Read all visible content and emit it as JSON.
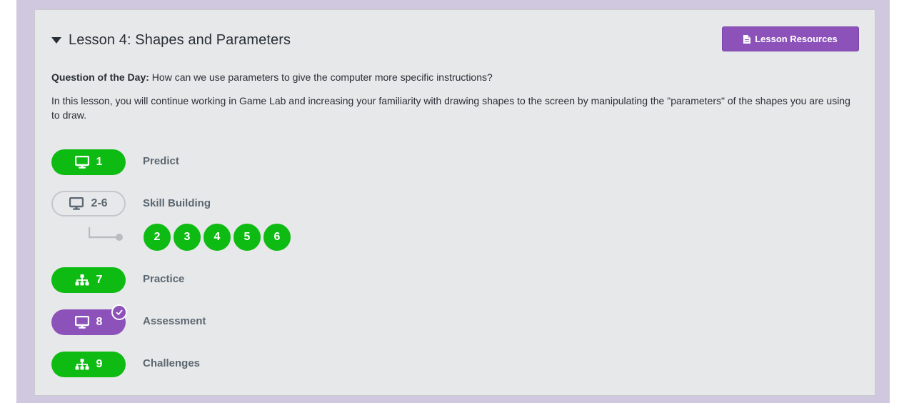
{
  "lesson": {
    "title": "Lesson 4: Shapes and Parameters",
    "resources_label": "Lesson Resources",
    "question_label": "Question of the Day:",
    "question_text": " How can we use parameters to give the computer more specific instructions?",
    "description": "In this lesson, you will continue working in Game Lab and increasing your familiarity with drawing shapes to the screen by manipulating the \"parameters\" of the shapes you are using to draw."
  },
  "levels": [
    {
      "number": "1",
      "label": "Predict",
      "icon": "desktop-icon",
      "status": "complete"
    },
    {
      "number": "2-6",
      "label": "Skill Building",
      "icon": "desktop-icon",
      "status": "progression"
    },
    {
      "number": "7",
      "label": "Practice",
      "icon": "sitemap-icon",
      "status": "complete"
    },
    {
      "number": "8",
      "label": "Assessment",
      "icon": "desktop-icon",
      "status": "assessment-submitted"
    },
    {
      "number": "9",
      "label": "Challenges",
      "icon": "sitemap-icon",
      "status": "complete"
    }
  ],
  "sublevels": [
    "2",
    "3",
    "4",
    "5",
    "6"
  ],
  "colors": {
    "complete": "#0ebb12",
    "assessment": "#8c52ba",
    "outline": "#c5c6ca",
    "background": "#cfc8de",
    "card": "#e7e8ea"
  }
}
